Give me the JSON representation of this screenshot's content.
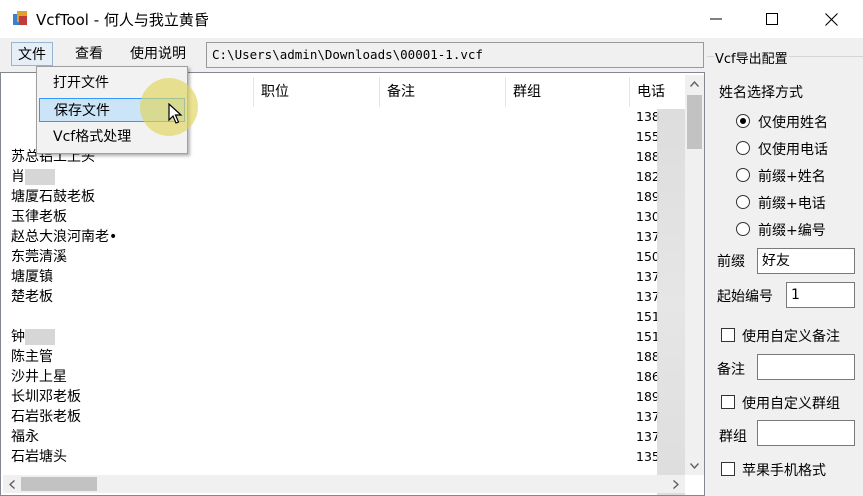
{
  "window": {
    "title": "VcfTool - 何人与我立黄昏",
    "minimize_glyph": "—",
    "maximize_glyph": "☐",
    "close_glyph": "✕"
  },
  "menu": {
    "file": "文件",
    "view": "查看",
    "help": "使用说明"
  },
  "file_path": "C:\\Users\\admin\\Downloads\\00001-1.vcf",
  "dropdown": {
    "items": [
      "打开文件",
      "保存文件",
      "Vcf格式处理"
    ],
    "hovered_index": 1
  },
  "table": {
    "columns": [
      "职位",
      "备注",
      "群组",
      "电话"
    ],
    "rows": [
      {
        "name": "",
        "phone": "138"
      },
      {
        "name": "",
        "phone": "155"
      },
      {
        "name": "苏总铝工上头",
        "phone": "188"
      },
      {
        "name": "肖",
        "phone": "182"
      },
      {
        "name": "塘厦石鼓老板",
        "phone": "189"
      },
      {
        "name": "玉律老板",
        "phone": "130"
      },
      {
        "name": "赵总大浪河南老•",
        "phone": "137"
      },
      {
        "name": "东莞清溪",
        "phone": "150"
      },
      {
        "name": "塘厦镇",
        "phone": "137"
      },
      {
        "name": "楚老板",
        "phone": "137"
      },
      {
        "name": "",
        "phone": "151"
      },
      {
        "name": "钟",
        "phone": "151"
      },
      {
        "name": "陈主管",
        "phone": "188"
      },
      {
        "name": "沙井上星",
        "phone": "186"
      },
      {
        "name": "长圳邓老板",
        "phone": "189"
      },
      {
        "name": "石岩张老板",
        "phone": "137"
      },
      {
        "name": "福永",
        "phone": "137"
      },
      {
        "name": "石岩塘头",
        "phone": "135"
      }
    ]
  },
  "settings": {
    "group_title": "Vcf导出配置",
    "name_mode_label": "姓名选择方式",
    "radios": [
      {
        "label": "仅使用姓名",
        "checked": true
      },
      {
        "label": "仅使用电话",
        "checked": false
      },
      {
        "label": "前缀+姓名",
        "checked": false
      },
      {
        "label": "前缀+电话",
        "checked": false
      },
      {
        "label": "前缀+编号",
        "checked": false
      }
    ],
    "prefix_label": "前缀",
    "prefix_value": "好友",
    "start_number_label": "起始编号",
    "start_number_value": "1",
    "custom_note_label": "使用自定义备注",
    "custom_note_checked": false,
    "note_label": "备注",
    "note_value": "",
    "custom_group_label": "使用自定义群组",
    "custom_group_checked": false,
    "group_label": "群组",
    "group_value": "",
    "apple_format_label": "苹果手机格式",
    "apple_format_checked": false
  },
  "colors": {
    "hover_bg": "#cce4f7",
    "hover_border": "#3399ff",
    "cursor_halo": "#e1d45a"
  }
}
